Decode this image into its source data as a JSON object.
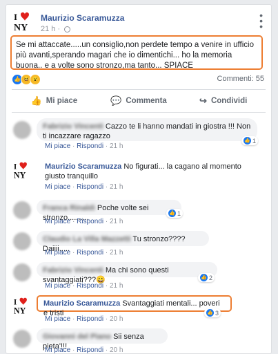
{
  "post": {
    "author": "Maurizio Scaramuzza",
    "time": "21 h",
    "sep": "·",
    "text": "Se mi attaccate.....un consiglio,non perdete tempo a venire in ufficio più avanti,sperando magari che io dimentichi... ho la memoria buona.. e a volte sono stronzo,ma tanto... SPIACE",
    "comments_count": "Commenti: 55"
  },
  "actions": {
    "like": "Mi piace",
    "comment": "Commenta",
    "share": "Condividi"
  },
  "comment_actions": {
    "like": "Mi piace",
    "reply": "Rispondi",
    "sep": "·"
  },
  "comments": [
    {
      "name": "Fabrizio Vincenti",
      "text": "Cazzo te li hanno mandati in giostra !!! Non ti incazzare ragazzo",
      "time": "21 h",
      "reactions": "1"
    },
    {
      "name": "Maurizio Scaramuzza",
      "text": "No figurati... la cagano al momento giusto tranquillo",
      "time": "21 h"
    },
    {
      "name": "Franca Rinaldi",
      "text": "Poche volte sei stronzo..........",
      "time": "21 h",
      "reactions": "1"
    },
    {
      "name": "Claudio La Villa Mazzetti",
      "text": "Tu stronzo???? Daiiii.....",
      "time": "21 h"
    },
    {
      "name": "Fabrizio Vincenti",
      "text": "Ma chi sono questi svantaggiati???😀",
      "time": "21 h",
      "reactions": "2"
    },
    {
      "name": "Maurizio Scaramuzza",
      "text": "Svantaggiati mentali... poveri e tristi",
      "time": "20 h",
      "reactions": "3"
    },
    {
      "name": "Giovanni del Piano",
      "text": "Sii senza pieta'!!!",
      "time": "20 h"
    }
  ]
}
